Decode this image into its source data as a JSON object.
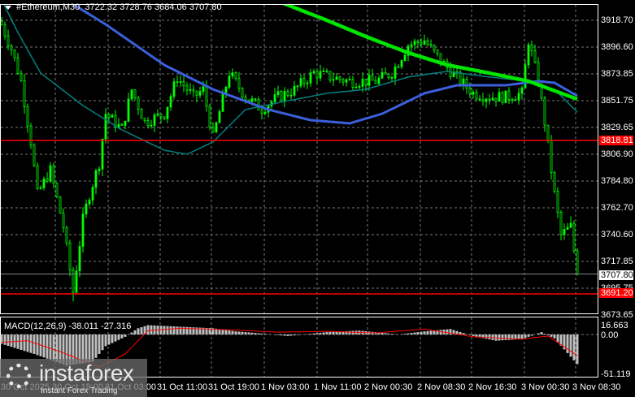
{
  "header": {
    "symbol": "#Ethereum,M30",
    "ohlc": "3722.32 3728.76 3684.06 3707.80"
  },
  "colors": {
    "candle": "#00ff00",
    "ma_fast": "#008080",
    "ma_mid": "#3c5fdc",
    "ma_slow": "#00e600",
    "level": "#ff0000",
    "macd_hist": "#c0c0c0",
    "macd_signal": "#ff0000"
  },
  "price_scale": [
    "3918.70",
    "3896.60",
    "3873.85",
    "3851.75",
    "3829.65",
    "3806.90",
    "3784.80",
    "3762.70",
    "3740.60",
    "3717.85",
    "3695.75",
    "3673.65"
  ],
  "levels": {
    "upper": "3818.81",
    "lower": "3691.20",
    "current": "3707.80"
  },
  "macd": {
    "label": "MACD(12,26,9) -38.011 -27.316",
    "scale": [
      "16.663",
      "0.00",
      "-51.119"
    ]
  },
  "time_axis": [
    "30 Oct 2025",
    "30 Oct 19:00",
    "31 Oct 03:00",
    "31 Oct 11:00",
    "31 Oct 19:00",
    "1 Nov 03:00",
    "1 Nov 11:00",
    "2 Nov 00:30",
    "2 Nov 08:30",
    "2 Nov 16:30",
    "3 Nov 00:30",
    "3 Nov 08:30"
  ],
  "watermark": {
    "brand": "instaforex",
    "tagline": "Instant Forex Trading"
  },
  "chart_data": {
    "type": "candlestick",
    "title": "#Ethereum,M30",
    "bars": 178,
    "ylim": [
      3673.65,
      3918.7
    ],
    "close_keypoints": [
      [
        0,
        3915
      ],
      [
        3,
        3895
      ],
      [
        6,
        3868
      ],
      [
        9,
        3818
      ],
      [
        11,
        3774
      ],
      [
        15,
        3794
      ],
      [
        19,
        3747
      ],
      [
        22,
        3693
      ],
      [
        25,
        3753
      ],
      [
        27,
        3774
      ],
      [
        30,
        3800
      ],
      [
        32,
        3841
      ],
      [
        37,
        3828
      ],
      [
        40,
        3861
      ],
      [
        44,
        3834
      ],
      [
        50,
        3841
      ],
      [
        54,
        3871
      ],
      [
        59,
        3855
      ],
      [
        62,
        3861
      ],
      [
        65,
        3821
      ],
      [
        70,
        3875
      ],
      [
        75,
        3855
      ],
      [
        80,
        3845
      ],
      [
        85,
        3855
      ],
      [
        90,
        3861
      ],
      [
        96,
        3875
      ],
      [
        102,
        3871
      ],
      [
        107,
        3868
      ],
      [
        115,
        3868
      ],
      [
        120,
        3875
      ],
      [
        125,
        3898
      ],
      [
        130,
        3902
      ],
      [
        135,
        3885
      ],
      [
        140,
        3871
      ],
      [
        145,
        3858
      ],
      [
        150,
        3855
      ],
      [
        155,
        3855
      ],
      [
        160,
        3858
      ],
      [
        162,
        3902
      ],
      [
        165,
        3868
      ],
      [
        167,
        3834
      ],
      [
        170,
        3774
      ],
      [
        172,
        3740
      ],
      [
        175,
        3747
      ],
      [
        177,
        3707.8
      ]
    ],
    "ma_fast": [
      [
        0,
        3935.6
      ],
      [
        5,
        3908.6
      ],
      [
        12,
        3874.8
      ],
      [
        25,
        3847.8
      ],
      [
        37,
        3827.6
      ],
      [
        50,
        3810.7
      ],
      [
        57,
        3807.3
      ],
      [
        65,
        3817.5
      ],
      [
        75,
        3844.5
      ],
      [
        87,
        3851.2
      ],
      [
        100,
        3858
      ],
      [
        112,
        3861.3
      ],
      [
        125,
        3871.5
      ],
      [
        137,
        3876.2
      ],
      [
        150,
        3871.5
      ],
      [
        162,
        3868.1
      ],
      [
        170,
        3861.3
      ],
      [
        177,
        3842.4
      ]
    ],
    "ma_mid": [
      [
        22,
        3932
      ],
      [
        32,
        3915.3
      ],
      [
        50,
        3881.6
      ],
      [
        65,
        3861.3
      ],
      [
        82,
        3844.5
      ],
      [
        95,
        3835.7
      ],
      [
        107,
        3833
      ],
      [
        117,
        3841
      ],
      [
        130,
        3858
      ],
      [
        140,
        3864.7
      ],
      [
        155,
        3864.7
      ],
      [
        165,
        3868.1
      ],
      [
        170,
        3866.7
      ],
      [
        177,
        3855.9
      ]
    ],
    "ma_slow": [
      [
        86,
        3933.5
      ],
      [
        100,
        3918.7
      ],
      [
        112,
        3905.2
      ],
      [
        125,
        3891.7
      ],
      [
        137,
        3881.6
      ],
      [
        150,
        3874.8
      ],
      [
        162,
        3868.1
      ],
      [
        177,
        3853.2
      ]
    ],
    "macd_hist": [
      [
        0,
        -12
      ],
      [
        10,
        -25
      ],
      [
        20,
        -40
      ],
      [
        28,
        -35
      ],
      [
        32,
        -15
      ],
      [
        38,
        -3
      ],
      [
        42,
        8
      ],
      [
        45,
        12
      ],
      [
        55,
        10
      ],
      [
        65,
        8
      ],
      [
        72,
        4
      ],
      [
        78,
        2
      ],
      [
        88,
        -2
      ],
      [
        100,
        3
      ],
      [
        110,
        5
      ],
      [
        122,
        0
      ],
      [
        130,
        4
      ],
      [
        138,
        7
      ],
      [
        145,
        -2
      ],
      [
        152,
        -8
      ],
      [
        160,
        -6
      ],
      [
        166,
        3
      ],
      [
        170,
        -5
      ],
      [
        177,
        -38
      ]
    ],
    "macd_signal": [
      [
        0,
        -10
      ],
      [
        8,
        -8
      ],
      [
        18,
        -22
      ],
      [
        30,
        -42
      ],
      [
        38,
        -25
      ],
      [
        45,
        5
      ],
      [
        55,
        8
      ],
      [
        70,
        6
      ],
      [
        85,
        3
      ],
      [
        100,
        4
      ],
      [
        115,
        2
      ],
      [
        130,
        7
      ],
      [
        145,
        -3
      ],
      [
        160,
        -6
      ],
      [
        168,
        -2
      ],
      [
        177,
        -27
      ]
    ],
    "macd_ylim": [
      -51.119,
      16.663
    ]
  }
}
